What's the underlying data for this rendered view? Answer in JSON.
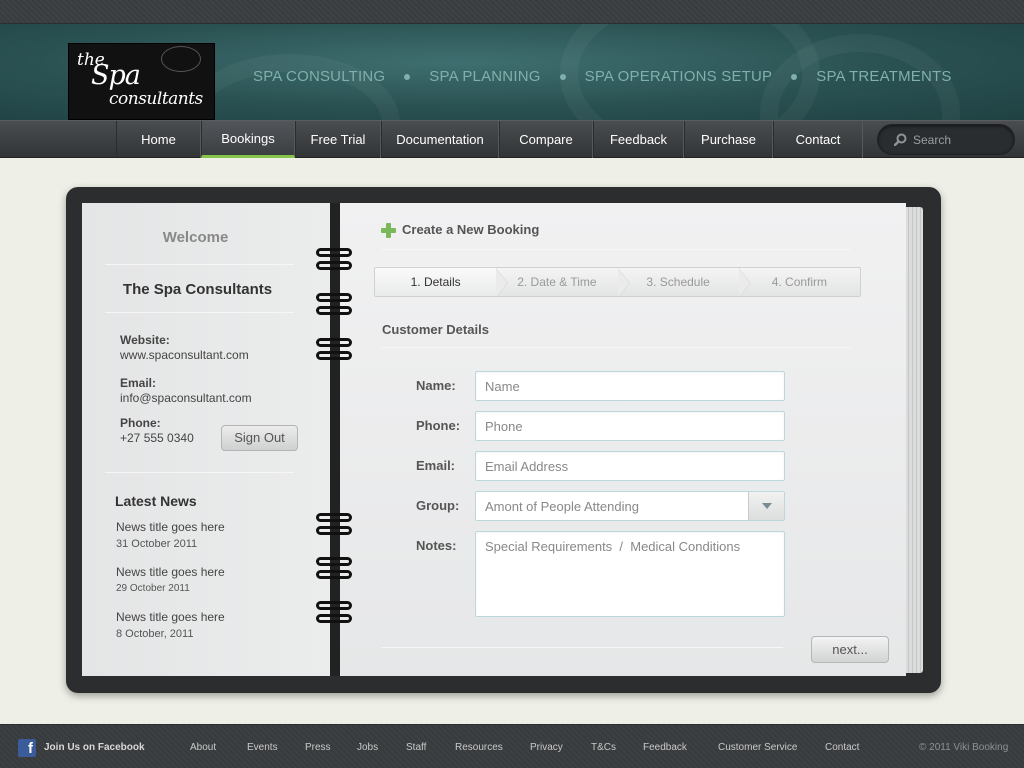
{
  "header": {
    "logo": {
      "line1": "the",
      "line2": "Spa",
      "line3": "consultants"
    },
    "services": [
      "SPA CONSULTING",
      "SPA PLANNING",
      "SPA OPERATIONS SETUP",
      "SPA TREATMENTS"
    ]
  },
  "nav": {
    "items": [
      {
        "label": "Home",
        "active": false
      },
      {
        "label": "Bookings",
        "active": true
      },
      {
        "label": "Free Trial",
        "active": false
      },
      {
        "label": "Documentation",
        "active": false
      },
      {
        "label": "Compare",
        "active": false
      },
      {
        "label": "Feedback",
        "active": false
      },
      {
        "label": "Purchase",
        "active": false
      },
      {
        "label": "Contact",
        "active": false
      }
    ],
    "search_placeholder": "Search"
  },
  "sidebar": {
    "welcome": "Welcome",
    "company": "The Spa Consultants",
    "website_label": "Website:",
    "website": "www.spaconsultant.com",
    "email_label": "Email:",
    "email": "info@spaconsultant.com",
    "phone_label": "Phone:",
    "phone": "+27 555 0340",
    "signout_label": "Sign Out",
    "news_heading": "Latest News",
    "news": [
      {
        "title": "News title goes here",
        "date": "31 October 2011"
      },
      {
        "title": "News title goes here",
        "date": "29 October 2011"
      },
      {
        "title": "News title goes here",
        "date": "8 October, 2011"
      }
    ]
  },
  "booking": {
    "title": "Create a New Booking",
    "steps": [
      {
        "label": "1. Details",
        "active": true
      },
      {
        "label": "2. Date & Time",
        "active": false
      },
      {
        "label": "3. Schedule",
        "active": false
      },
      {
        "label": "4. Confirm",
        "active": false
      }
    ],
    "section_title": "Customer Details",
    "fields": {
      "name_label": "Name:",
      "name_placeholder": "Name",
      "phone_label": "Phone:",
      "phone_placeholder": "Phone",
      "email_label": "Email:",
      "email_placeholder": "Email Address",
      "group_label": "Group:",
      "group_value": "Amont of People Attending",
      "notes_label": "Notes:",
      "notes_placeholder": "Special Requirements  /  Medical Conditions"
    },
    "next_label": "next..."
  },
  "footer": {
    "facebook_text": "Join Us on Facebook",
    "links": [
      "About",
      "Events",
      "Press",
      "Jobs",
      "Staff",
      "Resources",
      "Privacy",
      "T&Cs",
      "Feedback",
      "Customer Service",
      "Contact"
    ],
    "copyright": "© 2011 Viki Booking"
  },
  "colors": {
    "header_teal": "#2a5152",
    "service_text": "#7fb0ad",
    "active_underline": "#86c44a",
    "plus_green": "#7ab85a",
    "facebook_blue": "#3b5b9a"
  }
}
